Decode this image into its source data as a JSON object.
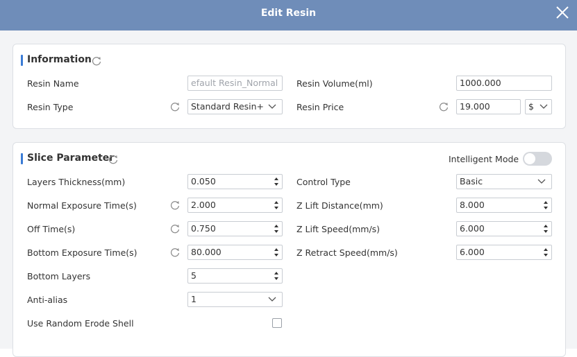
{
  "dialog": {
    "title": "Edit Resin",
    "close_icon": "close-icon"
  },
  "information": {
    "title": "Information",
    "resin_name": {
      "label": "Resin Name",
      "value": "efault Resin_Normal"
    },
    "resin_type": {
      "label": "Resin Type",
      "value": "Standard Resin+"
    },
    "resin_volume": {
      "label": "Resin Volume(ml)",
      "value": "1000.000"
    },
    "resin_price": {
      "label": "Resin Price",
      "value": "19.000",
      "currency": "$"
    }
  },
  "slice": {
    "title": "Slice Parameter",
    "intelligent_mode": {
      "label": "Intelligent Mode",
      "enabled": false
    },
    "layers_thickness": {
      "label": "Layers Thickness(mm)",
      "value": "0.050"
    },
    "normal_exposure": {
      "label": "Normal Exposure Time(s)",
      "value": "2.000"
    },
    "off_time": {
      "label": "Off Time(s)",
      "value": "0.750"
    },
    "bottom_exposure": {
      "label": "Bottom Exposure Time(s)",
      "value": "80.000"
    },
    "bottom_layers": {
      "label": "Bottom Layers",
      "value": "5"
    },
    "anti_alias": {
      "label": "Anti-alias",
      "value": "1"
    },
    "random_erode": {
      "label": "Use Random Erode Shell",
      "checked": false
    },
    "control_type": {
      "label": "Control Type",
      "value": "Basic"
    },
    "z_lift_distance": {
      "label": "Z Lift Distance(mm)",
      "value": "8.000"
    },
    "z_lift_speed": {
      "label": "Z Lift Speed(mm/s)",
      "value": "6.000"
    },
    "z_retract_speed": {
      "label": "Z Retract Speed(mm/s)",
      "value": "6.000"
    }
  },
  "colors": {
    "titlebar": "#6f8db9",
    "accent": "#3a7bd5",
    "background": "#f3f4f6"
  }
}
